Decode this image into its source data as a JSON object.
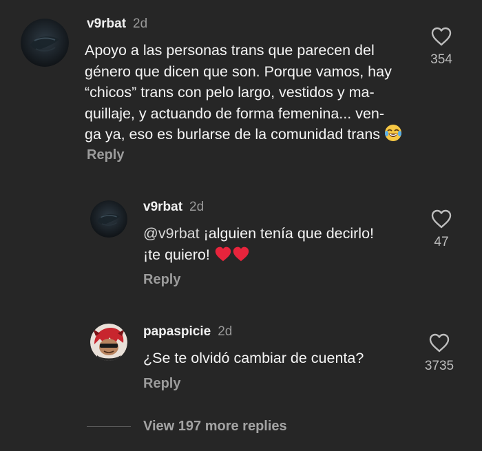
{
  "comments": [
    {
      "username": "v9rbat",
      "time": "2d",
      "lines": [
        "Apoyo a las personas trans que parecen del",
        "género que dicen que son. Porque vamos, hay",
        "“chicos” trans con pelo largo, vestidos y ma-",
        "quillaje, y actuando de forma femenina... ven-",
        "ga ya, eso es burlarse de la comunidad trans"
      ],
      "reply_label": "Reply",
      "like_count": "354",
      "emoji": "face-with-tears-of-joy"
    },
    {
      "username": "v9rbat",
      "time": "2d",
      "mention": "@v9rbat",
      "lines": [
        "¡alguien tenía que decirlo!",
        "¡te quiero!"
      ],
      "reply_label": "Reply",
      "like_count": "47",
      "emoji": "red-heart x2"
    },
    {
      "username": "papaspicie",
      "time": "2d",
      "lines": [
        "¿Se te olvidó cambiar de cuenta?"
      ],
      "reply_label": "Reply",
      "like_count": "3735"
    }
  ],
  "view_more": "View 197 more replies",
  "colors": {
    "background": "#262626",
    "text": "#f1f1f1",
    "muted": "#9a9a9a",
    "heart_red": "#e0245e"
  }
}
